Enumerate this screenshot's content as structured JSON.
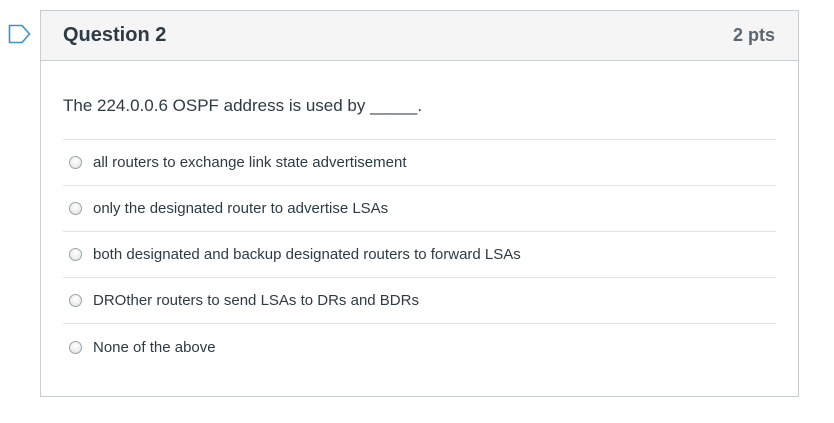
{
  "question": {
    "title": "Question 2",
    "points": "2 pts",
    "text": "The 224.0.0.6 OSPF address is used by _____."
  },
  "answers": [
    {
      "label": "all routers to exchange link state advertisement"
    },
    {
      "label": "only the designated router to advertise LSAs"
    },
    {
      "label": "both designated and backup designated routers to forward LSAs"
    },
    {
      "label": "DROther routers to send LSAs to DRs and BDRs"
    },
    {
      "label": "None of the above"
    }
  ],
  "colors": {
    "flag": "#3a93c9",
    "header_bg": "#f5f5f5",
    "border": "#c7cdd1",
    "text": "#2d3b45"
  },
  "icons": {
    "flag": "flag-bookmark-icon"
  }
}
